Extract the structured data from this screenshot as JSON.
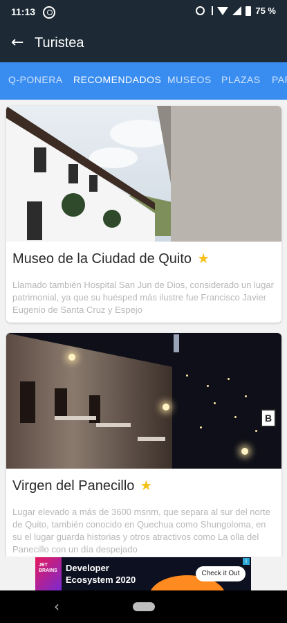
{
  "status_bar": {
    "time": "11:13",
    "battery": "75 %",
    "icons": [
      "whatsapp-icon",
      "alarm-icon",
      "bluetooth-icon",
      "wifi-icon",
      "signal-icon",
      "battery-icon"
    ]
  },
  "app_bar": {
    "title": "Turistea",
    "back_icon": "arrow-left-icon"
  },
  "tabs": [
    {
      "label": "Q-PONERA",
      "active": false
    },
    {
      "label": "RECOMENDADOS",
      "active": true
    },
    {
      "label": "MUSEOS",
      "active": false
    },
    {
      "label": "PLAZAS",
      "active": false
    },
    {
      "label": "PAR",
      "active": false
    }
  ],
  "colors": {
    "app_bar": "#1d2a35",
    "tab_bar": "#3a8df0",
    "star": "#f4c21b",
    "description_text": "#b8b8b8"
  },
  "places": [
    {
      "title": "Museo de la Ciudad de Quito",
      "favorite": true,
      "description": "Llamado también Hospital San Jun de Dios, considerado un lugar patrimonial, ya que su huésped más ilustre fue Francisco Javier Eugenio de Santa Cruz y Espejo"
    },
    {
      "title": "Virgen del Panecillo",
      "favorite": true,
      "description": "Lugar elevado a más de 3600 msnm, que separa al sur del norte de Quito, también conocido en Quechua como Shungoloma, en su el lugar guarda historias y otros atractivos como La olla del Panecillo con un día despejado"
    }
  ],
  "ad": {
    "logo_text": "JET BRAINS",
    "headline": "Developer Ecosystem 2020",
    "cta": "Check it Out",
    "adchoices": "i"
  },
  "sign_text": "B"
}
